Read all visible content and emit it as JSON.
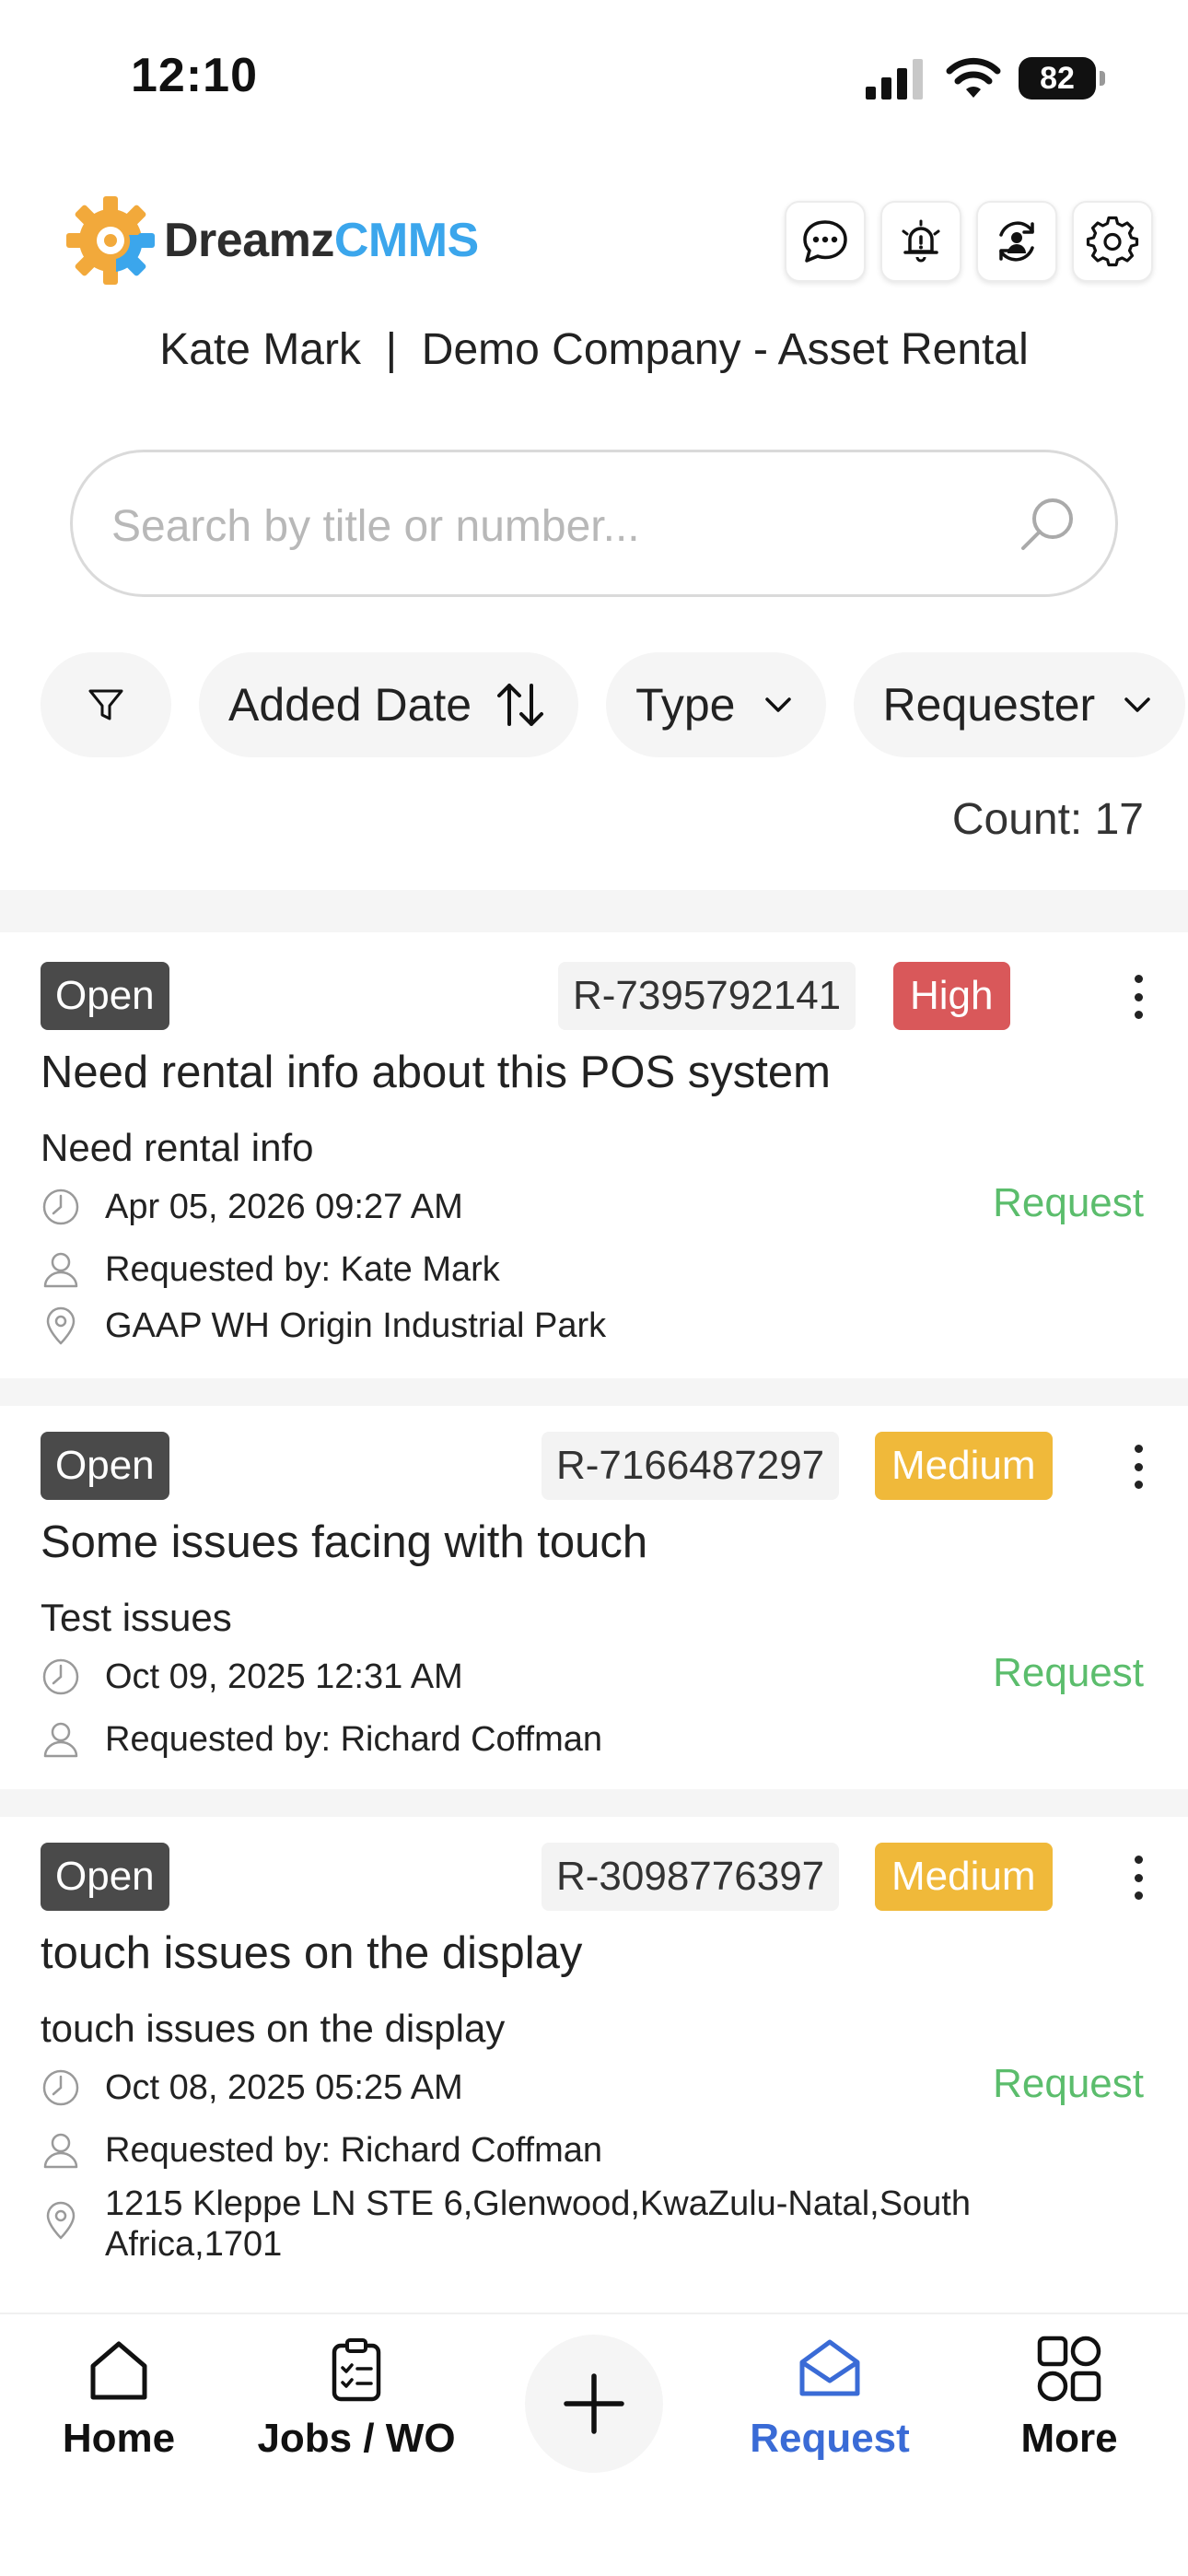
{
  "status_bar": {
    "time": "12:10",
    "battery": "82"
  },
  "header": {
    "logo_part1": "Dreamz",
    "logo_part2": "CMMS",
    "icons": [
      "chat-icon",
      "alarm-icon",
      "user-switch-icon",
      "gear-icon"
    ],
    "user_name": "Kate Mark",
    "separator": "|",
    "company": "Demo Company - Asset Rental"
  },
  "search": {
    "placeholder": "Search by title or number..."
  },
  "filters": {
    "added_date": "Added Date",
    "type": "Type",
    "requester": "Requester"
  },
  "count_label": "Count: 17",
  "requests": [
    {
      "status": "Open",
      "number": "R-7395792141",
      "priority": "High",
      "title": "Need rental info about this POS system",
      "description": "Need rental info",
      "date": "Apr 05, 2026 09:27 AM",
      "requested_by": "Requested by: Kate Mark",
      "location": "GAAP WH Origin Industrial Park",
      "kind": "Request"
    },
    {
      "status": "Open",
      "number": "R-7166487297",
      "priority": "Medium",
      "title": "Some issues facing with touch",
      "description": "Test issues",
      "date": "Oct 09, 2025 12:31 AM",
      "requested_by": "Requested by: Richard Coffman",
      "kind": "Request"
    },
    {
      "status": "Open",
      "number": "R-3098776397",
      "priority": "Medium",
      "title": "touch issues on the display",
      "description": "touch issues on the display",
      "date": "Oct 08, 2025 05:25 AM",
      "requested_by": "Requested by: Richard Coffman",
      "location_line1": "1215 Kleppe LN STE 6,Glenwood,KwaZulu-Natal,South",
      "location_line2": "Africa,1701",
      "kind": "Request"
    }
  ],
  "colors": {
    "high": "#d9585a",
    "medium": "#f0b93a",
    "request_link": "#5bbd6c",
    "active_nav": "#3a6bd6",
    "logo_accent": "#3ba6ec"
  },
  "bottom_nav": {
    "home": "Home",
    "jobs": "Jobs / WO",
    "request": "Request",
    "more": "More"
  }
}
